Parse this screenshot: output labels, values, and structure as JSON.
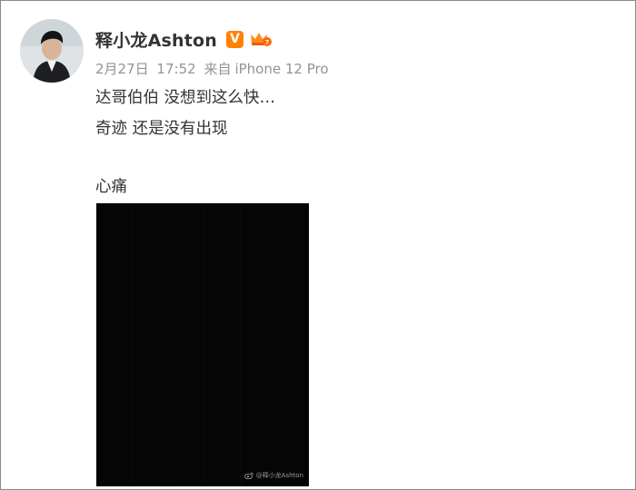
{
  "post": {
    "author": {
      "name": "释小龙Ashton",
      "verified_badge": "V",
      "avatar_icon": "avatar-photo"
    },
    "meta": {
      "date": "2月27日",
      "time": "17:52",
      "source_prefix": "来自",
      "source_device": "iPhone 12 Pro"
    },
    "content": {
      "lines": [
        "达哥伯伯 没想到这么快…",
        "奇迹 还是没有出现",
        "",
        "心痛"
      ]
    },
    "image": {
      "watermark": "@释小龙Ashton",
      "watermark_icon": "weibo-logo-icon"
    }
  },
  "colors": {
    "verified": "#ff8200",
    "text": "#333333",
    "meta": "#939393",
    "photo_bg": "#050505"
  }
}
